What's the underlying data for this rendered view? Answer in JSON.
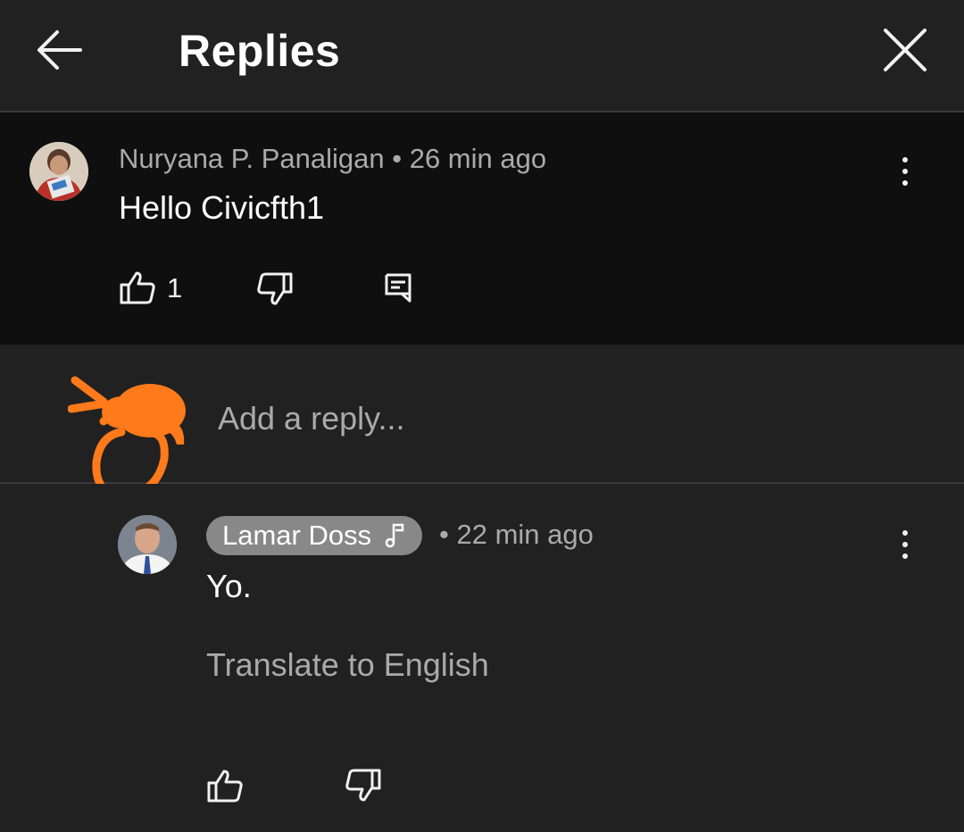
{
  "header": {
    "title": "Replies",
    "back_icon": "arrow-left-icon",
    "close_icon": "close-icon"
  },
  "parent_comment": {
    "author": "Nuryana P. Panaligan",
    "separator": "•",
    "time": "26 min ago",
    "text": "Hello Civicfth1",
    "likes": "1"
  },
  "reply_input": {
    "placeholder": "Add a reply..."
  },
  "reply": {
    "author": "Lamar Doss",
    "author_badge_icon": "music-note-icon",
    "separator": "•",
    "time": "22 min ago",
    "text": "Yo.",
    "translate": "Translate to English"
  },
  "colors": {
    "background": "#212121",
    "parent_background": "#0f0f0f",
    "annotation": "#ff7a1a",
    "chip": "#888888"
  }
}
